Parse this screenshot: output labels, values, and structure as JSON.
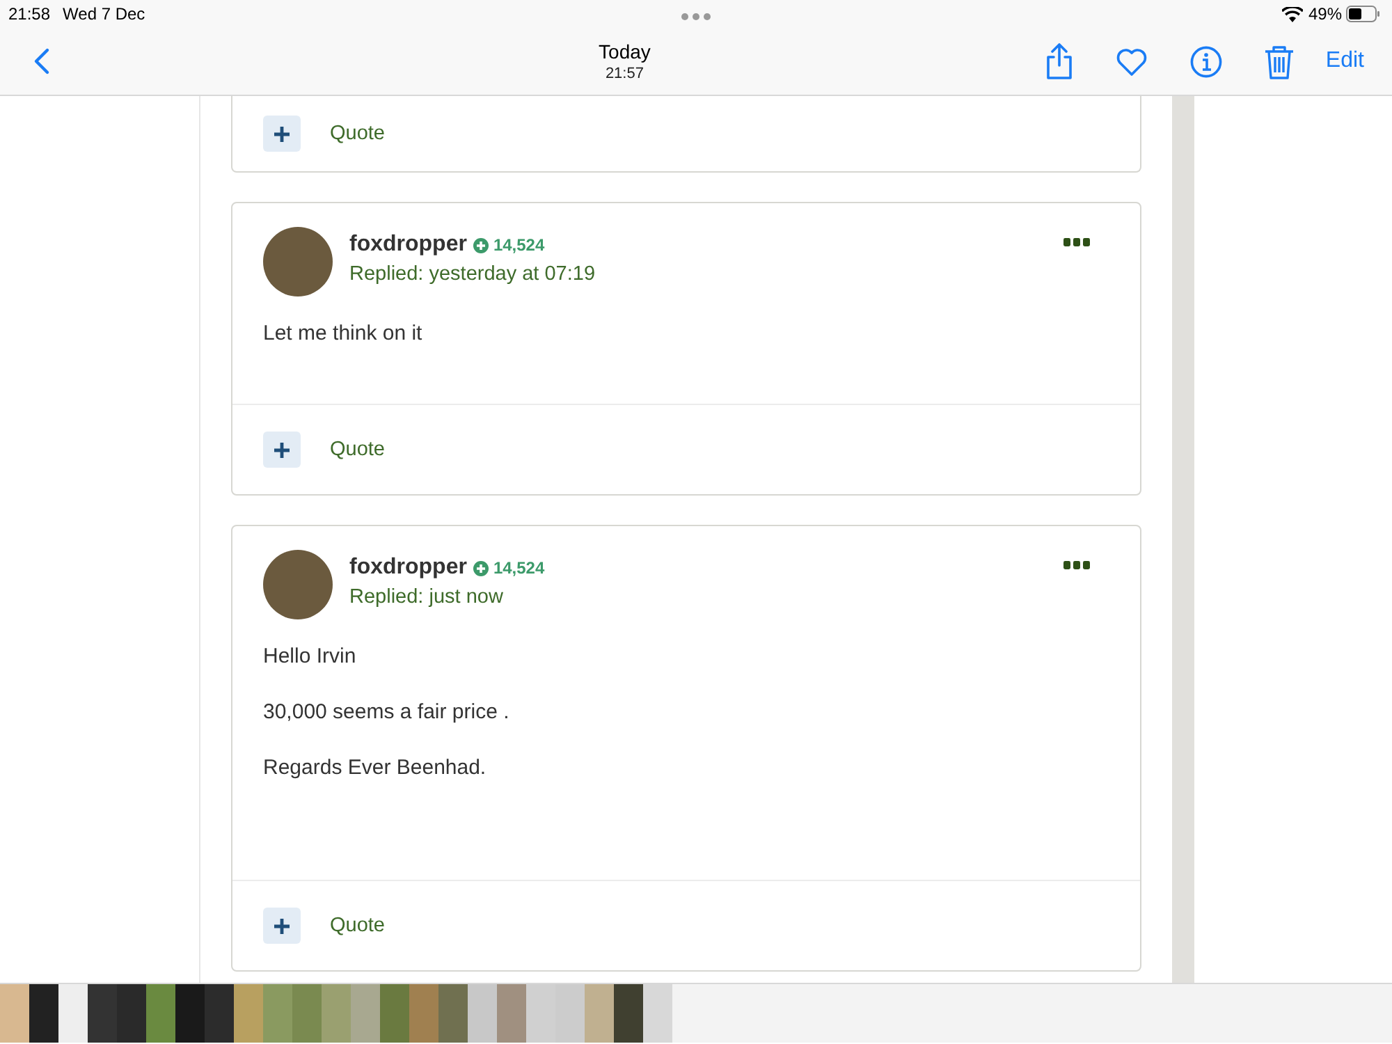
{
  "status_bar": {
    "time": "21:58",
    "date": "Wed 7 Dec",
    "battery": "49%"
  },
  "nav_bar": {
    "title": "Today",
    "subtitle": "21:57",
    "edit": "Edit"
  },
  "posts": [
    {
      "cut_off": true,
      "quote": "Quote"
    },
    {
      "cut_off": false,
      "author": "foxdropper",
      "reputation": "14,524",
      "replied": "Replied: yesterday at 07:19",
      "body": [
        "Let me think on it"
      ],
      "quote": "Quote"
    },
    {
      "cut_off": false,
      "author": "foxdropper",
      "reputation": "14,524",
      "replied": "Replied: just now",
      "body": [
        "Hello Irvin",
        "30,000 seems a fair price .",
        "Regards Ever Beenhad."
      ],
      "quote": "Quote"
    }
  ]
}
